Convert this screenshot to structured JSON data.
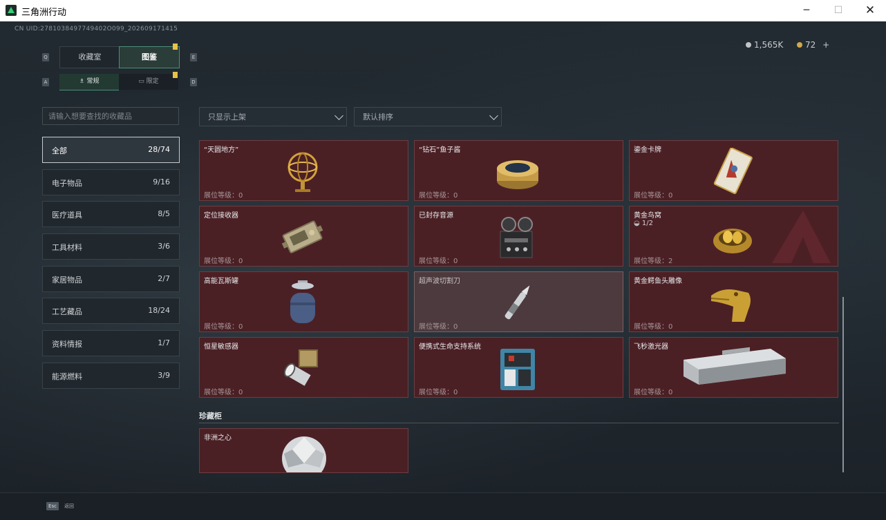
{
  "window": {
    "title": "三角洲行动",
    "min_glyph": "─",
    "max_glyph": "☐",
    "close_glyph": "✕"
  },
  "uid": "CN UID:2781038497749402O099_202609171415",
  "currency": [
    {
      "value": "1,565K",
      "color": "#c0c4c8"
    },
    {
      "value": "72",
      "plus": "+",
      "color": "#d0a84e"
    }
  ],
  "keys": {
    "q": "Q",
    "e": "E",
    "a": "A",
    "d": "D",
    "esc": "Esc"
  },
  "tabs": {
    "collection": "收藏室",
    "catalog": "图鉴"
  },
  "subtabs": {
    "normal": "常规",
    "limited": "限定"
  },
  "search": {
    "placeholder": "请输入想要查找的收藏品"
  },
  "filters": {
    "show": "只显示上架",
    "sort": "默认排序"
  },
  "categories": [
    {
      "label": "全部",
      "count": "28/74"
    },
    {
      "label": "电子物品",
      "count": "9/16"
    },
    {
      "label": "医疗道具",
      "count": "8/5"
    },
    {
      "label": "工具材料",
      "count": "3/6"
    },
    {
      "label": "家居物品",
      "count": "2/7"
    },
    {
      "label": "工艺藏品",
      "count": "18/24"
    },
    {
      "label": "资料情报",
      "count": "1/7"
    },
    {
      "label": "能源燃料",
      "count": "3/9"
    }
  ],
  "level_label": "展位等级：",
  "items": [
    {
      "name": "“天圆地方”",
      "level": "0",
      "icon": "armillary-sphere"
    },
    {
      "name": "“钻石”鱼子酱",
      "level": "0",
      "icon": "caviar-tin"
    },
    {
      "name": "鎏金卡牌",
      "level": "0",
      "icon": "gilded-card"
    },
    {
      "name": "定位接收器",
      "level": "0",
      "icon": "gps-receiver"
    },
    {
      "name": "已封存音源",
      "level": "0",
      "icon": "tape-recorder"
    },
    {
      "name": "黄金鸟窝",
      "sub": "1/2",
      "level": "2",
      "icon": "golden-nest"
    },
    {
      "name": "高能瓦斯罐",
      "level": "0",
      "icon": "gas-canister"
    },
    {
      "name": "超声波切割刀",
      "level": "0",
      "icon": "ultrasonic-knife"
    },
    {
      "name": "黄金鳄鱼头雕像",
      "level": "0",
      "icon": "gold-crocodile-head"
    },
    {
      "name": "恒星敏感器",
      "level": "0",
      "icon": "star-sensor"
    },
    {
      "name": "便携式生命支持系统",
      "level": "0",
      "icon": "life-support-system"
    },
    {
      "name": "飞秒激光器",
      "level": "0",
      "icon": "femtosecond-laser"
    }
  ],
  "treasure": {
    "title": "珍藏柜",
    "items": [
      {
        "name": "非洲之心",
        "icon": "diamond"
      }
    ]
  },
  "footer": {
    "back": "返回"
  }
}
